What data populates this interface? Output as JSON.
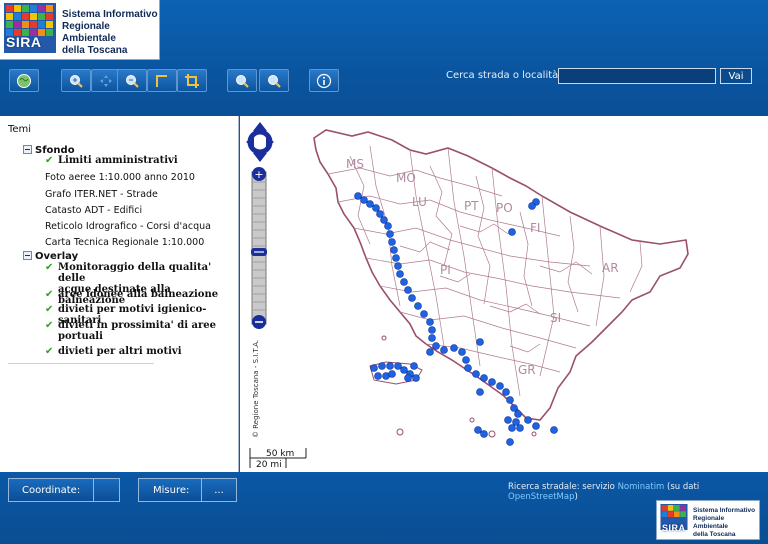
{
  "header": {
    "logo_abbrev": "SIRA",
    "logo_lines": [
      "Sistema Informativo",
      "Regionale Ambientale",
      "della Toscana"
    ],
    "search": {
      "label": "Cerca strada o località",
      "value": "",
      "button_label": "Vai"
    }
  },
  "toolbar": [
    {
      "name": "full-extent-button",
      "icon": "globe-icon"
    },
    {
      "name": "zoom-in-button",
      "icon": "zoom-in-icon"
    },
    {
      "name": "pan-button",
      "icon": "pan-icon"
    },
    {
      "name": "zoom-out-button",
      "icon": "zoom-out-icon"
    },
    {
      "name": "measure-button",
      "icon": "ruler-icon"
    },
    {
      "name": "crop-button",
      "icon": "crop-icon"
    },
    {
      "name": "previous-view-button",
      "icon": "zoom-previous-icon"
    },
    {
      "name": "next-view-button",
      "icon": "zoom-next-icon"
    },
    {
      "name": "info-button",
      "icon": "info-icon"
    }
  ],
  "left_panel": {
    "title": "Temi",
    "groups": [
      {
        "label": "Sfondo",
        "items": [
          {
            "label": "Limiti amministrativi",
            "checked": true
          },
          {
            "label": "Foto aeree 1:10.000 anno 2010",
            "checked": false
          },
          {
            "label": "Grafo ITER.NET - Strade",
            "checked": false
          },
          {
            "label": "Catasto ADT - Edifici",
            "checked": false
          },
          {
            "label": "Reticolo Idrografico - Corsi d'acqua",
            "checked": false
          },
          {
            "label": "Carta Tecnica Regionale 1:10.000",
            "checked": false
          }
        ]
      },
      {
        "label": "Overlay",
        "items": [
          {
            "label_lines": [
              "Monitoraggio della qualita' delle",
              "acque destinate alla balneazione"
            ],
            "checked": true
          },
          {
            "label": "aree idonee alla balneazione",
            "checked": true
          },
          {
            "label": "divieti per motivi igienico-sanitari",
            "checked": true
          },
          {
            "label_lines": [
              "divieti in prossimita' di aree",
              "portuali"
            ],
            "checked": true
          },
          {
            "label": "divieti per altri motivi",
            "checked": true
          }
        ]
      }
    ]
  },
  "map": {
    "province_labels": [
      "MS",
      "MO",
      "LU",
      "PT",
      "PO",
      "FI",
      "PI",
      "AR",
      "SI",
      "GR"
    ],
    "copyright": "© Regione Toscana - S.I.T.A.",
    "scale": {
      "metric": "50 km",
      "imperial": "20 mi"
    },
    "colors": {
      "boundary": "#9a4f6a",
      "point": "#1f63e0",
      "point_stroke": "#0a2f9a",
      "zoom_control": "#1a2f9c"
    }
  },
  "footer": {
    "coordinate_label": "Coordinate:",
    "coordinate_value": "",
    "measure_label": "Misure:",
    "measure_value": "...",
    "attribution_prefix": "Ricerca stradale: servizio",
    "attribution_service": "Nominatim",
    "attribution_middle": "(su dati",
    "attribution_source": "OpenStreetMap",
    "attribution_suffix": ")"
  }
}
